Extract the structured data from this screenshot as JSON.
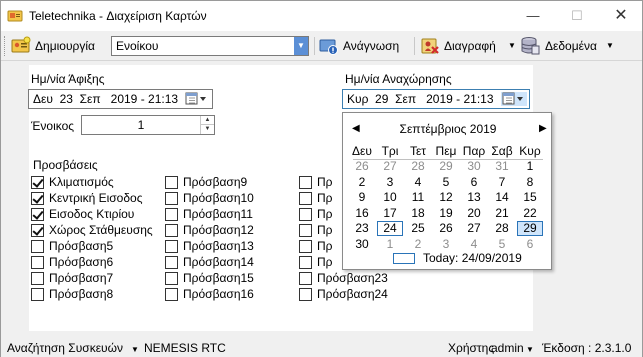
{
  "window": {
    "title": "Teletechnika - Διαχείριση Καρτών"
  },
  "toolbar": {
    "create_label": "Δημιουργία",
    "type_combo_value": "Ενοίκου",
    "read_label": "Ανάγνωση",
    "delete_label": "Διαγραφή",
    "data_label": "Δεδομένα"
  },
  "form": {
    "arrival_label": "Ημ/νία Άφιξης",
    "arrival_value": "Δευ  23  Σεπ   2019 - 21:13",
    "departure_label": "Ημ/νία Αναχώρησης",
    "departure_value": "Κυρ  29  Σεπ   2019 - 21:13",
    "tenant_label": "Ένοικος",
    "tenant_value": "1",
    "access_label": "Προσβάσεις"
  },
  "access_cols": [
    [
      {
        "label": "Κλιματισμός",
        "checked": true
      },
      {
        "label": "Κεντρική Εισοδος",
        "checked": true
      },
      {
        "label": "Εισοδος Κτιρίου",
        "checked": true
      },
      {
        "label": "Χώρος Στάθμευσης",
        "checked": true
      },
      {
        "label": "Πρόσβαση5",
        "checked": false
      },
      {
        "label": "Πρόσβαση6",
        "checked": false
      },
      {
        "label": "Πρόσβαση7",
        "checked": false
      },
      {
        "label": "Πρόσβαση8",
        "checked": false
      }
    ],
    [
      {
        "label": "Πρόσβαση9",
        "checked": false
      },
      {
        "label": "Πρόσβαση10",
        "checked": false
      },
      {
        "label": "Πρόσβαση11",
        "checked": false
      },
      {
        "label": "Πρόσβαση12",
        "checked": false
      },
      {
        "label": "Πρόσβαση13",
        "checked": false
      },
      {
        "label": "Πρόσβαση14",
        "checked": false
      },
      {
        "label": "Πρόσβαση15",
        "checked": false
      },
      {
        "label": "Πρόσβαση16",
        "checked": false
      }
    ],
    [
      {
        "label": "Πρ",
        "checked": false
      },
      {
        "label": "Πρ",
        "checked": false
      },
      {
        "label": "Πρ",
        "checked": false
      },
      {
        "label": "Πρ",
        "checked": false
      },
      {
        "label": "Πρ",
        "checked": false
      },
      {
        "label": "Πρ",
        "checked": false
      },
      {
        "label": "Πρόσβαση23",
        "checked": false
      },
      {
        "label": "Πρόσβαση24",
        "checked": false
      }
    ]
  ],
  "calendar": {
    "month_title": "Σεπτέμβριος 2019",
    "weekdays": [
      "Δευ",
      "Τρι",
      "Τετ",
      "Πεμ",
      "Παρ",
      "Σαβ",
      "Κυρ"
    ],
    "weeks": [
      [
        "26",
        "27",
        "28",
        "29",
        "30",
        "31",
        "1"
      ],
      [
        "2",
        "3",
        "4",
        "5",
        "6",
        "7",
        "8"
      ],
      [
        "9",
        "10",
        "11",
        "12",
        "13",
        "14",
        "15"
      ],
      [
        "16",
        "17",
        "18",
        "19",
        "20",
        "21",
        "22"
      ],
      [
        "23",
        "24",
        "25",
        "26",
        "27",
        "28",
        "29"
      ],
      [
        "30",
        "1",
        "2",
        "3",
        "4",
        "5",
        "6"
      ]
    ],
    "today_label": "Today: 24/09/2019"
  },
  "status": {
    "search_label": "Αναζήτηση Συσκευών",
    "device": "NEMESIS RTC",
    "user_label": "Χρήστης",
    "user": "admin",
    "version": "Έκδοση : 2.3.1.0"
  },
  "colors": {
    "accent": "#2a74b8",
    "selection": "#cfe5fb",
    "combo_button": "#5b8fd6"
  }
}
